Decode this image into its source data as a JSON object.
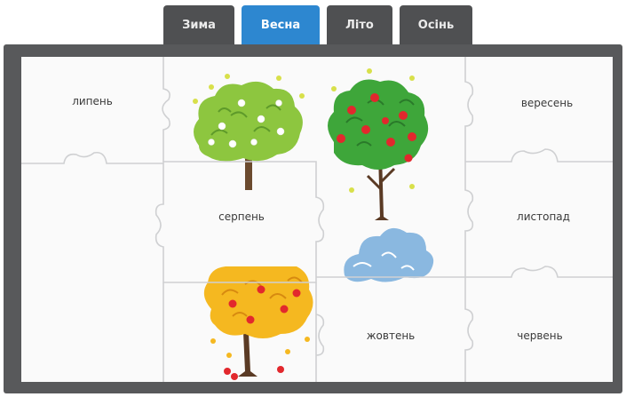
{
  "tabs": [
    {
      "label": "Зима",
      "active": false
    },
    {
      "label": "Весна",
      "active": true
    },
    {
      "label": "Літо",
      "active": false
    },
    {
      "label": "Осінь",
      "active": false
    }
  ],
  "pieces": {
    "p1": "липень",
    "p2": "вересень",
    "p3": "серпень",
    "p4": "листопад",
    "p5": "жовтень",
    "p6": "червень"
  },
  "colors": {
    "active_tab": "#2d87d0",
    "inactive_tab": "#4f5052",
    "frame": "#58595b",
    "piece_border": "#cfd0d2",
    "spring_tree": "#8dc63f",
    "summer_tree": "#3ea63a",
    "autumn_tree": "#f5b820",
    "winter_cloud": "#8ab8e0",
    "fruit": "#e2282d"
  },
  "icons": [
    "spring-tree-icon",
    "summer-tree-icon",
    "autumn-tree-icon",
    "winter-tree-icon"
  ]
}
